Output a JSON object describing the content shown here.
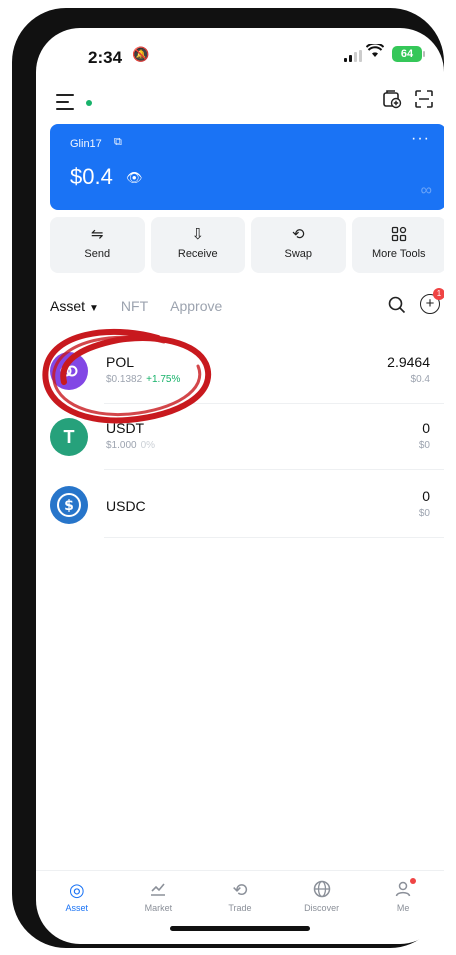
{
  "status_bar": {
    "time": "2:34",
    "battery": "64"
  },
  "wallet": {
    "name": "Glin17",
    "balance": "$0.4",
    "menu": "···"
  },
  "actions": [
    {
      "label": "Send",
      "icon": "swap-horizontal-icon"
    },
    {
      "label": "Receive",
      "icon": "download-icon"
    },
    {
      "label": "Swap",
      "icon": "swap-icon"
    },
    {
      "label": "More Tools",
      "icon": "grid-icon"
    }
  ],
  "tabs": [
    {
      "label": "Asset",
      "active": true
    },
    {
      "label": "NFT",
      "active": false
    },
    {
      "label": "Approve",
      "active": false
    }
  ],
  "notifications": {
    "count": "1"
  },
  "assets": [
    {
      "symbol": "POL",
      "price": "$0.1382",
      "change": "+1.75%",
      "amount": "2.9464",
      "value": "$0.4",
      "color": "#8247e5"
    },
    {
      "symbol": "USDT",
      "price": "$1.000",
      "change": "0%",
      "amount": "0",
      "value": "$0",
      "color": "#26a17b"
    },
    {
      "symbol": "USDC",
      "price": "",
      "change": "",
      "amount": "0",
      "value": "$0",
      "color": "#2775ca"
    }
  ],
  "bottom_nav": [
    {
      "label": "Asset",
      "active": true
    },
    {
      "label": "Market",
      "active": false
    },
    {
      "label": "Trade",
      "active": false
    },
    {
      "label": "Discover",
      "active": false
    },
    {
      "label": "Me",
      "active": false
    }
  ],
  "colors": {
    "accent": "#1a73f5",
    "positive": "#17b26a",
    "annotation": "#c8191e"
  }
}
